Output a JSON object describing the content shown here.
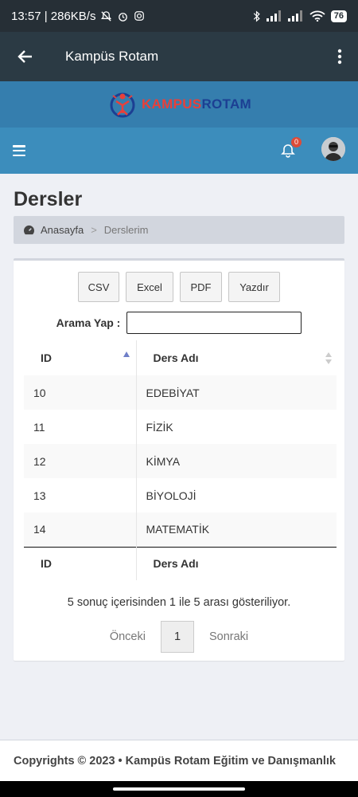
{
  "statusbar": {
    "time_speed": "13:57 | 286KB/s",
    "battery": "76"
  },
  "appbar": {
    "title": "Kampüs Rotam"
  },
  "logo": {
    "text_red": "KAMPUS",
    "text_blue": "ROTAM"
  },
  "navbar": {
    "notification_count": "0"
  },
  "page": {
    "title": "Dersler",
    "breadcrumb_home": "Anasayfa",
    "breadcrumb_sep": ">",
    "breadcrumb_current": "Derslerim"
  },
  "toolbar": {
    "csv": "CSV",
    "excel": "Excel",
    "pdf": "PDF",
    "print": "Yazdır"
  },
  "search": {
    "label": "Arama Yap :",
    "value": ""
  },
  "table": {
    "headers": [
      "ID",
      "Ders Adı"
    ],
    "rows": [
      {
        "id": "10",
        "name": "EDEBİYAT"
      },
      {
        "id": "11",
        "name": "FİZİK"
      },
      {
        "id": "12",
        "name": "KİMYA"
      },
      {
        "id": "13",
        "name": "BİYOLOJİ"
      },
      {
        "id": "14",
        "name": "MATEMATİK"
      }
    ],
    "footers": [
      "ID",
      "Ders Adı"
    ]
  },
  "pagination": {
    "info": "5 sonuç içerisinden 1 ile 5 arası gösteriliyor.",
    "prev": "Önceki",
    "page": "1",
    "next": "Sonraki"
  },
  "footer": {
    "text": "Copyrights © 2023 • Kampüs Rotam Eğitim ve Danışmanlık"
  }
}
